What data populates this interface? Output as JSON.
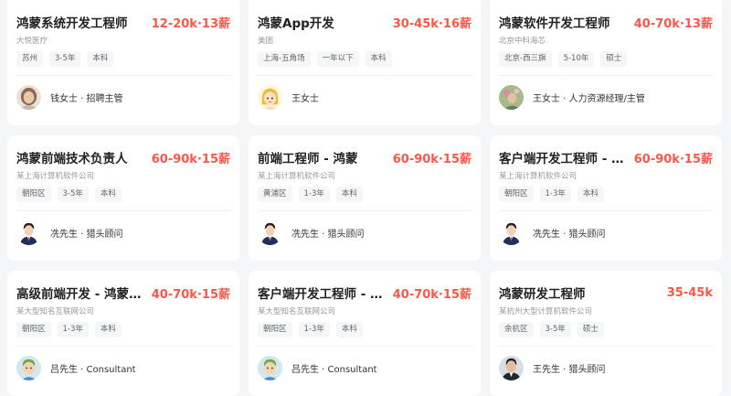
{
  "jobs": [
    {
      "title": "鸿蒙系统开发工程师",
      "salary": "12-20k·13薪",
      "company": "大悦医疗",
      "tags": [
        "苏州",
        "3-5年",
        "本科"
      ],
      "recruiter": "钱女士 · 招聘主管",
      "avatar_icon": "avatar-photo-woman-icon"
    },
    {
      "title": "鸿蒙App开发",
      "salary": "30-45k·16薪",
      "company": "美团",
      "tags": [
        "上海-五角场",
        "一年以下",
        "本科"
      ],
      "recruiter": "王女士",
      "avatar_icon": "avatar-cartoon-girl-icon"
    },
    {
      "title": "鸿蒙软件开发工程师",
      "salary": "40-70k·13薪",
      "company": "北京中科海芯",
      "tags": [
        "北京-西三旗",
        "5-10年",
        "硕士"
      ],
      "recruiter": "王女士 · 人力资源经理/主管",
      "avatar_icon": "avatar-photo-flowers-icon"
    },
    {
      "title": "鸿蒙前端技术负责人",
      "salary": "60-90k·15薪",
      "company": "某上海计算机软件公司",
      "tags": [
        "朝阳区",
        "3-5年",
        "本科"
      ],
      "recruiter": "冼先生 · 猎头顾问",
      "avatar_icon": "avatar-suit-man-icon"
    },
    {
      "title": "前端工程师 - 鸿蒙",
      "salary": "60-90k·15薪",
      "company": "某上海计算机软件公司",
      "tags": [
        "黄浦区",
        "1-3年",
        "本科"
      ],
      "recruiter": "冼先生 · 猎头顾问",
      "avatar_icon": "avatar-suit-man-icon"
    },
    {
      "title": "客户端开发工程师 - 鸿蒙",
      "salary": "60-90k·15薪",
      "company": "某上海计算机软件公司",
      "tags": [
        "朝阳区",
        "1-3年",
        "本科"
      ],
      "recruiter": "冼先生 · 猎头顾问",
      "avatar_icon": "avatar-suit-man-icon"
    },
    {
      "title": "高级前端开发 - 鸿蒙（…",
      "salary": "40-70k·15薪",
      "company": "某大型知名互联网公司",
      "tags": [
        "朝阳区",
        "1-3年",
        "本科"
      ],
      "recruiter": "吕先生 · Consultant",
      "avatar_icon": "avatar-cartoon-boy-icon"
    },
    {
      "title": "客户端开发工程师 - 鸿…",
      "salary": "40-70k·15薪",
      "company": "某大型知名互联网公司",
      "tags": [
        "朝阳区",
        "1-3年",
        "本科"
      ],
      "recruiter": "吕先生 · Consultant",
      "avatar_icon": "avatar-cartoon-boy-icon"
    },
    {
      "title": "鸿蒙研发工程师",
      "salary": "35-45k",
      "company": "某杭州大型计算机软件公司",
      "tags": [
        "余杭区",
        "3-5年",
        "硕士"
      ],
      "recruiter": "王先生 · 猎头顾问",
      "avatar_icon": "avatar-photo-man-icon"
    }
  ],
  "colors": {
    "salary": "#fe574a",
    "title": "#222222",
    "page_bg": "#f5f6f8"
  }
}
